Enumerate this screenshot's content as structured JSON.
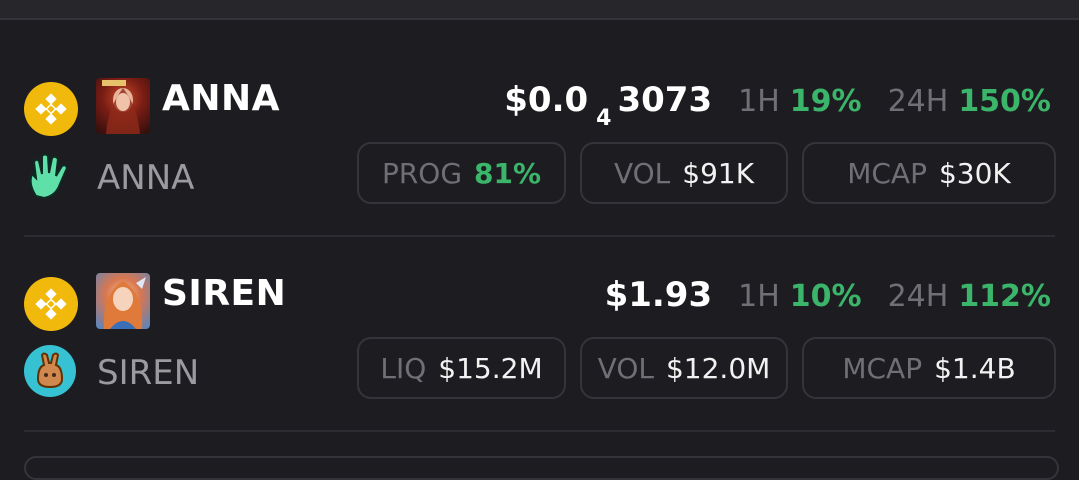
{
  "colors": {
    "green": "#3ab56a",
    "muted": "#6f6f76",
    "bnb": "#f0b90b",
    "background": "#1d1d21"
  },
  "tokens": [
    {
      "ticker": "ANNA",
      "name": "ANNA",
      "chain_icon": "bnb-icon",
      "dex_icon": "hand-icon",
      "price_main": "$0.0",
      "price_subscript": "4",
      "price_tail": "3073",
      "h1_label": "1H",
      "h1_change": "19%",
      "h24_label": "24H",
      "h24_change": "150%",
      "stats": [
        {
          "label": "PROG",
          "value": "81%",
          "highlight": true
        },
        {
          "label": "VOL",
          "value": "$91K",
          "highlight": false
        },
        {
          "label": "MCAP",
          "value": "$30K",
          "highlight": false
        }
      ]
    },
    {
      "ticker": "SIREN",
      "name": "SIREN",
      "chain_icon": "bnb-icon",
      "dex_icon": "pancakeswap-icon",
      "price_main": "$1.93",
      "h1_label": "1H",
      "h1_change": "10%",
      "h24_label": "24H",
      "h24_change": "112%",
      "stats": [
        {
          "label": "LIQ",
          "value": "$15.2M",
          "highlight": false
        },
        {
          "label": "VOL",
          "value": "$12.0M",
          "highlight": false
        },
        {
          "label": "MCAP",
          "value": "$1.4B",
          "highlight": false
        }
      ]
    }
  ]
}
